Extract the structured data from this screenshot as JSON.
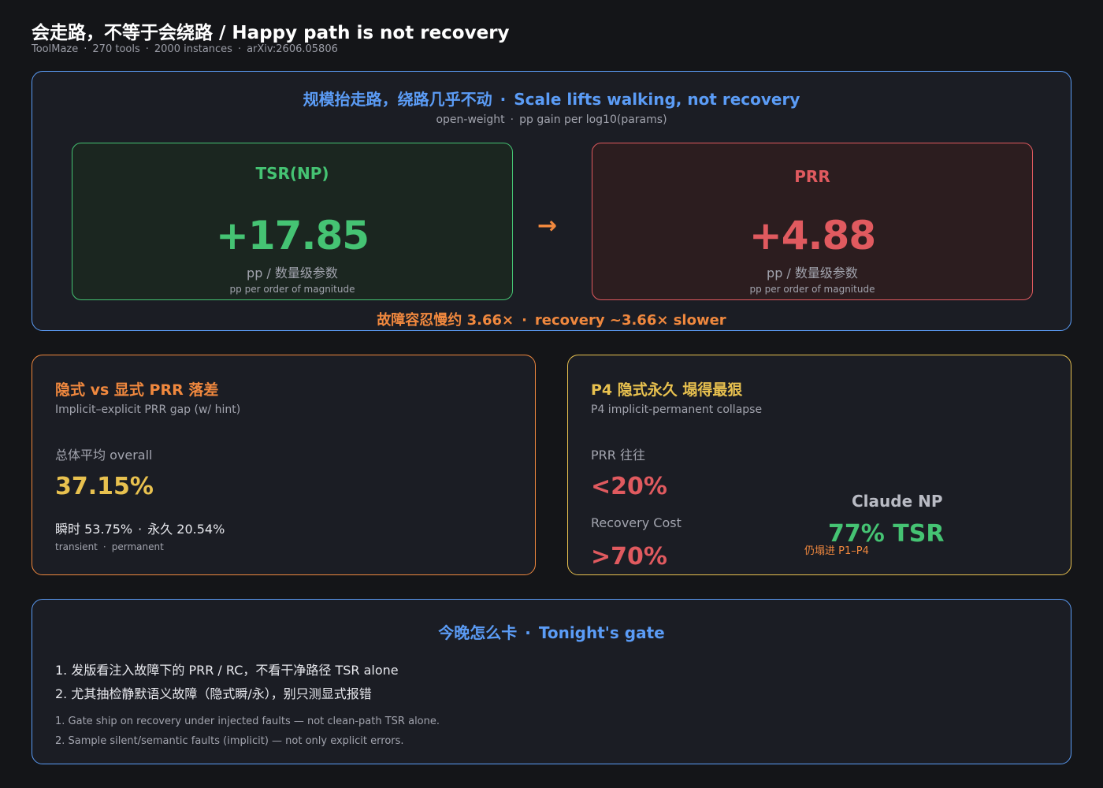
{
  "header": {
    "title": "会走路，不等于会绕路 / Happy path is not recovery",
    "meta": [
      "ToolMaze",
      "270 tools",
      "2000 instances",
      "arXiv:2606.05806"
    ],
    "separator": "·"
  },
  "scale": {
    "heading_zh": "规模抬走路，绕路几乎不动",
    "heading_en": "Scale lifts walking, not recovery",
    "subtitle_a": "open-weight",
    "subtitle_b": "pp gain per log10(params)",
    "tsr": {
      "label": "TSR(NP)",
      "value": "+17.85",
      "unit": "pp / 数量级参数",
      "unit_en": "pp per order of magnitude"
    },
    "arrow": "→",
    "prr": {
      "label": "PRR",
      "value": "+4.88",
      "unit": "pp / 数量级参数",
      "unit_en": "pp per order of magnitude"
    },
    "note_zh": "故障容忍慢约 3.66×",
    "note_en": "recovery ~3.66× slower"
  },
  "gap": {
    "heading": "隐式 vs 显式 PRR 落差",
    "subheading": "Implicit–explicit PRR gap (w/ hint)",
    "overall_label": "总体平均  overall",
    "overall_value": "37.15%",
    "transient": "瞬时 53.75%",
    "permanent": "永久 20.54%",
    "transient_en": "transient",
    "permanent_en": "permanent"
  },
  "collapse": {
    "heading": "P4 隐式永久 塌得最狠",
    "subheading": "P4 implicit-permanent collapse",
    "prr_label": "PRR 往往",
    "prr_value": "<20%",
    "rc_label": "Recovery Cost",
    "rc_value": ">70%",
    "claude_label": "Claude NP",
    "claude_value": "77% TSR",
    "claude_note": "仍塌进 P1–P4"
  },
  "gate": {
    "heading_zh": "今晚怎么卡",
    "heading_en": "Tonight's gate",
    "items": [
      "1. 发版看注入故障下的 PRR / RC，不看干净路径 TSR alone",
      "2. 尤其抽检静默语义故障（隐式瞬/永），别只测显式报错"
    ],
    "items_en": [
      "1. Gate ship on recovery under injected faults — not clean-path TSR alone.",
      "2. Sample silent/semantic faults (implicit) — not only explicit errors."
    ]
  },
  "colors": {
    "background": "#141518",
    "blue": "#5b9cf6",
    "green": "#45c373",
    "red": "#e05a5f",
    "orange": "#f0883e",
    "yellow": "#e8c14f"
  }
}
